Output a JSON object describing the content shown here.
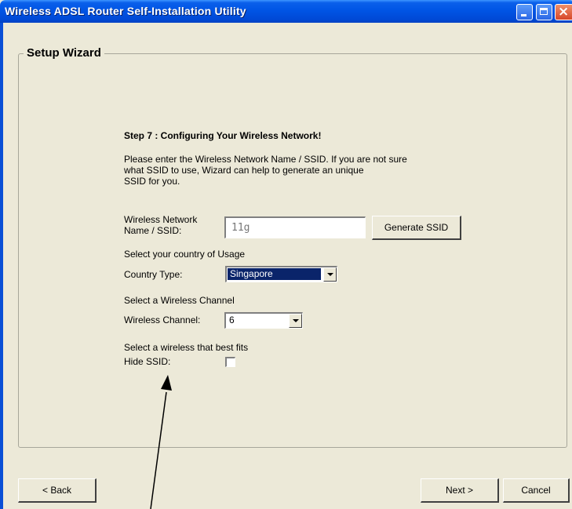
{
  "window": {
    "title": "Wireless ADSL Router Self-Installation Utility",
    "title_bar_color": "#0055e5",
    "face_color": "#ece9d8",
    "controls": [
      "minimize-icon",
      "maximize-icon",
      "close-icon"
    ]
  },
  "wizard": {
    "group_title": "Setup Wizard",
    "step_title": "Step 7 : Configuring Your Wireless Network!",
    "instructions": [
      "Please enter the Wireless Network Name / SSID. If you are not sure",
      "what SSID to use, Wizard can help to generate an unique",
      "SSID for you."
    ],
    "ssid": {
      "label_line1": "Wireless Network",
      "label_line2": "Name / SSID:",
      "value": "11g",
      "generate_label": "Generate SSID"
    },
    "country": {
      "prompt": "Select your country of Usage",
      "label": "Country Type:",
      "value": "Singapore",
      "selection_color": "#0a246a"
    },
    "channel": {
      "prompt": "Select a Wireless Channel",
      "label": "Wireless Channel:",
      "value": "6"
    },
    "hide_ssid": {
      "prompt": "Select a wireless that best fits",
      "label": "Hide SSID:",
      "checked": false
    }
  },
  "footer": {
    "back_label": "< Back",
    "next_label": "Next >",
    "cancel_label": "Cancel"
  }
}
